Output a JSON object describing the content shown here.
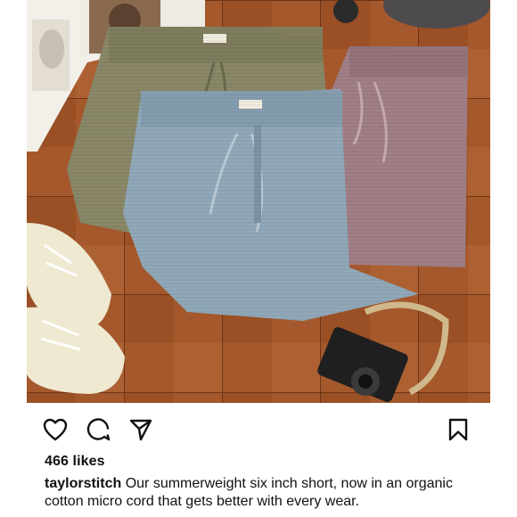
{
  "post": {
    "photo_alt_icon": "product-photo",
    "actions": {
      "like_icon": "heart-icon",
      "comment_icon": "speech-bubble-icon",
      "share_icon": "paper-plane-icon",
      "save_icon": "bookmark-icon"
    },
    "likes_text": "466 likes",
    "caption": {
      "username": "taylorstitch",
      "text": "Our summerweight six inch short, now in an organic cotton micro cord that gets better with every wear."
    }
  },
  "colors": {
    "background": "#ffffff",
    "text": "#111111",
    "tile": "#a0552a",
    "short_olive": "#8a8a6a",
    "short_blue": "#8fa6b6",
    "short_mauve": "#a07f86",
    "sneaker": "#efe9d2"
  }
}
